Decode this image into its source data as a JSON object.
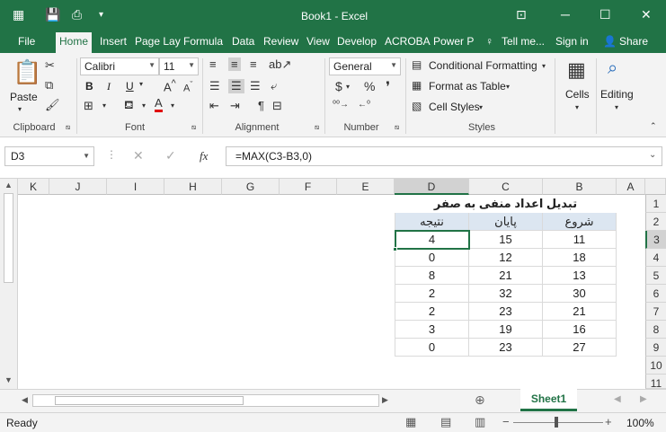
{
  "window": {
    "title": "Book1 - Excel"
  },
  "tabs": [
    "File",
    "Home",
    "Insert",
    "Page Lay",
    "Formula",
    "Data",
    "Review",
    "View",
    "Develop",
    "ACROBA",
    "Power P"
  ],
  "tell_me": "Tell me...",
  "sign_in": "Sign in",
  "share": "Share",
  "ribbon": {
    "paste": "Paste",
    "font_name": "Calibri",
    "font_size": "11",
    "bold": "B",
    "italic": "I",
    "underline": "U",
    "number_format": "General",
    "conditional_formatting": "Conditional Formatting",
    "format_as_table": "Format as Table",
    "cell_styles": "Cell Styles",
    "cells": "Cells",
    "editing": "Editing",
    "groups": [
      "Clipboard",
      "Font",
      "Alignment",
      "Number",
      "Styles"
    ]
  },
  "formula_bar": {
    "name_box": "D3",
    "fx": "fx",
    "formula": "=MAX(C3-B3,0)"
  },
  "columns": [
    "K",
    "J",
    "I",
    "H",
    "G",
    "F",
    "E",
    "D",
    "C",
    "B",
    "A"
  ],
  "rows": [
    "1",
    "2",
    "3",
    "4",
    "5",
    "6",
    "7",
    "8",
    "9",
    "10",
    "11"
  ],
  "sheet": {
    "title": "تبدیل اعداد منفی به صفر",
    "headers": {
      "B": "شروع",
      "C": "پایان",
      "D": "نتیجه"
    },
    "data": [
      {
        "B": "11",
        "C": "15",
        "D": "4"
      },
      {
        "B": "18",
        "C": "12",
        "D": "0"
      },
      {
        "B": "13",
        "C": "21",
        "D": "8"
      },
      {
        "B": "30",
        "C": "32",
        "D": "2"
      },
      {
        "B": "21",
        "C": "23",
        "D": "2"
      },
      {
        "B": "16",
        "C": "19",
        "D": "3"
      },
      {
        "B": "27",
        "C": "23",
        "D": "0"
      }
    ]
  },
  "sheet_tab": "Sheet1",
  "status": {
    "ready": "Ready",
    "zoom": "100%"
  },
  "colors": {
    "accent": "#217346",
    "header_fill": "#dce6f1"
  }
}
